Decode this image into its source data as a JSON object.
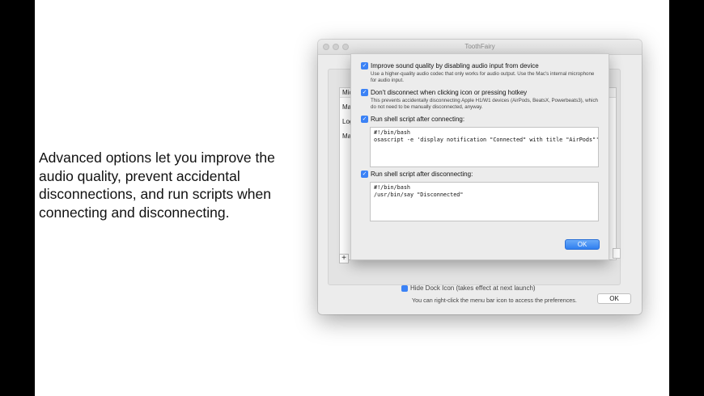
{
  "caption": "Advanced options let you improve the audio quality, prevent accidental disconnections, and run scripts when connecting and disconnecting.",
  "window": {
    "title": "ToothFairy",
    "list_rows": [
      "Mic",
      "Ma",
      "Log",
      "Ma"
    ],
    "add_button": "+",
    "hide_dock_text": "Hide Dock Icon (takes effect at next launch)",
    "right_click_text": "You can right-click the menu bar icon to access the preferences.",
    "ok_label": "OK"
  },
  "sheet": {
    "options": [
      {
        "label": "Improve sound quality by disabling audio input from device",
        "checked": true,
        "description": "Use a higher-quality audio codec that only works for audio output. Use the Mac's internal microphone for audio input."
      },
      {
        "label": "Don't disconnect when clicking icon or pressing hotkey",
        "checked": true,
        "description": "This prevents accidentally disconnecting Apple H1/W1 devices (AirPods, BeatsX, Powerbeats3), which do not need to be manually disconnected, anyway."
      },
      {
        "label": "Run shell script after connecting:",
        "checked": true,
        "script": "#!/bin/bash\nosascript -e 'display notification \"Connected\" with title \"AirPods\"'"
      },
      {
        "label": "Run shell script after disconnecting:",
        "checked": true,
        "script": "#!/bin/bash\n/usr/bin/say \"Disconnected\""
      }
    ],
    "ok_label": "OK"
  },
  "colors": {
    "accent": "#3b82f6",
    "window_bg": "#ececec",
    "slide_bg": "#ffffff",
    "letterbox": "#000000"
  }
}
